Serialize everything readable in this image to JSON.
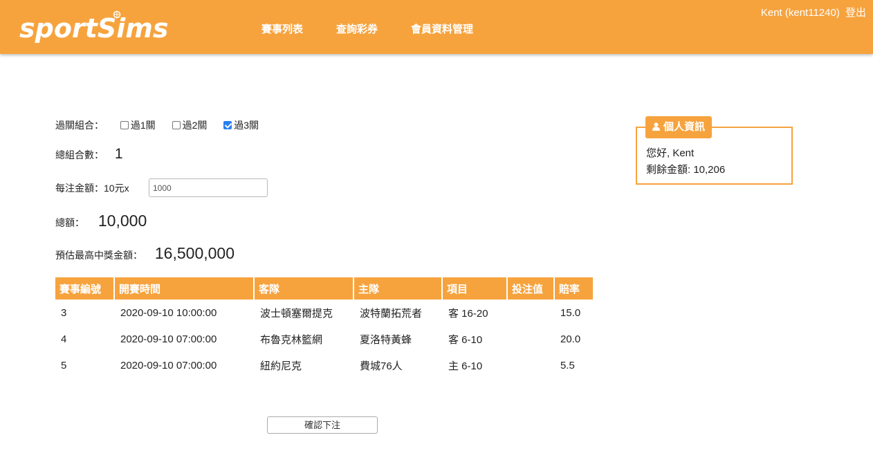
{
  "navbar": {
    "logo_text": "sportSims",
    "links": [
      "賽事列表",
      "查詢彩券",
      "會員資料管理"
    ],
    "user": "Kent (kent11240)",
    "logout": "登出"
  },
  "form": {
    "combo_label": "過關組合：",
    "combo_options": [
      {
        "label": "過1關",
        "checked": false
      },
      {
        "label": "過2關",
        "checked": false
      },
      {
        "label": "過3關",
        "checked": true
      }
    ],
    "total_combos_label": "總組合數：",
    "total_combos_value": "1",
    "bet_amount_label": "每注金額：10元x",
    "bet_amount_value": "1000",
    "total_label": "總額：",
    "total_value": "10,000",
    "max_prize_label": "預估最高中獎金額：",
    "max_prize_value": "16,500,000"
  },
  "table": {
    "headers": [
      "賽事編號",
      "開賽時間",
      "客隊",
      "主隊",
      "項目",
      "投注值",
      "賠率"
    ],
    "rows": [
      [
        "3",
        "2020-09-10 10:00:00",
        "波士頓塞爾提克",
        "波特蘭拓荒者",
        "客 16-20",
        "",
        "15.0"
      ],
      [
        "4",
        "2020-09-10 07:00:00",
        "布魯克林籃網",
        "夏洛特黃蜂",
        "客 6-10",
        "",
        "20.0"
      ],
      [
        "5",
        "2020-09-10 07:00:00",
        "紐約尼克",
        "費城76人",
        "主 6-10",
        "",
        "5.5"
      ]
    ]
  },
  "submit_label": "確認下注",
  "info": {
    "title": "個人資訊",
    "greeting": "您好, Kent",
    "balance": "剩餘金額: 10,206"
  },
  "colors": {
    "accent": "#f6a33e",
    "checkbox": "#2a7ff0"
  }
}
